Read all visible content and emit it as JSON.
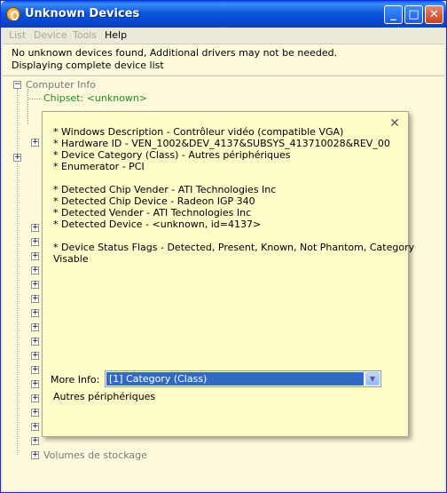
{
  "window": {
    "title": "Unknown Devices",
    "buttons": {
      "minimize": "_",
      "maximize": "□",
      "close": "✕"
    }
  },
  "menu": [
    {
      "label": "List",
      "enabled": false
    },
    {
      "label": "Device",
      "enabled": false
    },
    {
      "label": "Tools",
      "enabled": false
    },
    {
      "label": "Help",
      "enabled": true
    }
  ],
  "status": {
    "line1": "No unknown devices found, Additional drivers may not be needed.",
    "line2": "Displaying complete device list"
  },
  "tree": {
    "computer_info": "Computer Info",
    "chipset": "Chipset: <unknown>",
    "last_items": [
      "Volumes de stockage"
    ]
  },
  "popup": {
    "close_label": "✕",
    "lines": [
      "* Windows Description - Contrôleur vidéo (compatible VGA)",
      "* Hardware ID - VEN_1002&DEV_4137&SUBSYS_413710028&REV_00",
      "* Device Category (Class) - Autres périphériques",
      "* Enumerator - PCI",
      "",
      "* Detected Chip Vender - ATI Technologies Inc",
      "* Detected Chip Device - Radeon IGP 340",
      "* Detected Vender - ATI Technologies Inc",
      "* Detected Device - <unknown, id=4137>",
      "",
      "* Device Status Flags - Detected, Present, Known, Not Phantom, Category",
      "Visable"
    ],
    "more_info_label": "More Info:",
    "more_info_selected": "[1] Category (Class)",
    "more_info_value": "Autres périphériques"
  },
  "colors": {
    "titlebar": "#0a55de",
    "panel_bg": "#fdfbdc",
    "popup_bg": "#fdfbc8",
    "select_highlight": "#316ac5",
    "chipset_text": "#1e8c1e"
  }
}
